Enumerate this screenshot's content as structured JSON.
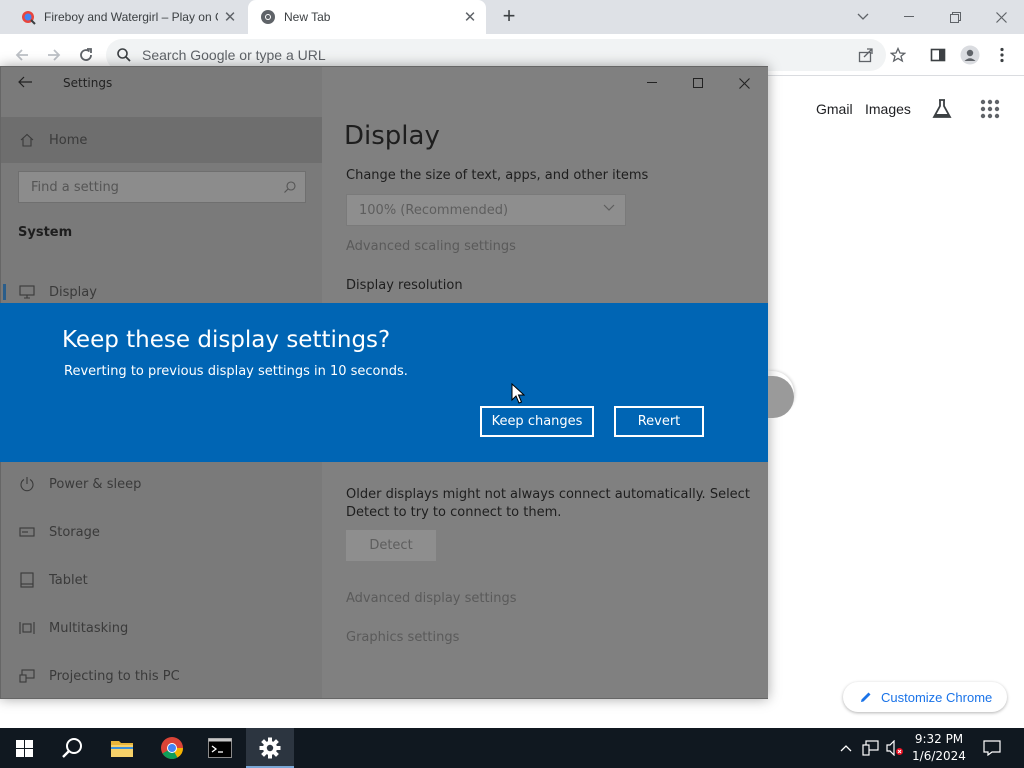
{
  "browser": {
    "tabs": [
      {
        "title": "Fireboy and Watergirl – Play on C",
        "close": "✕"
      },
      {
        "title": "New Tab",
        "close": "✕"
      }
    ],
    "new_tab": "+",
    "omnibox_placeholder": "Search Google or type a URL"
  },
  "ntp": {
    "links": [
      "Gmail",
      "Images"
    ],
    "customize_label": "Customize Chrome"
  },
  "settings": {
    "window_title": "Settings",
    "home_label": "Home",
    "search_placeholder": "Find a setting",
    "group_label": "System",
    "nav_items": [
      {
        "label": "Display",
        "icon": "monitor-icon"
      },
      {
        "label": "Power & sleep",
        "icon": "power-icon"
      },
      {
        "label": "Storage",
        "icon": "storage-icon"
      },
      {
        "label": "Tablet",
        "icon": "tablet-icon"
      },
      {
        "label": "Multitasking",
        "icon": "multitasking-icon"
      },
      {
        "label": "Projecting to this PC",
        "icon": "projecting-icon"
      }
    ],
    "heading": "Display",
    "scale_label": "Change the size of text, apps, and other items",
    "scale_value": "100% (Recommended)",
    "advanced_scaling": "Advanced scaling settings",
    "resolution_label": "Display resolution",
    "older_displays_text_line1": "Older displays might not always connect automatically. Select",
    "older_displays_text_line2": "Detect to try to connect to them.",
    "detect_label": "Detect",
    "advanced_display": "Advanced display settings",
    "graphics_settings": "Graphics settings"
  },
  "dialog": {
    "title": "Keep these display settings?",
    "message": "Reverting to previous display settings in 10 seconds.",
    "keep_label": "Keep changes",
    "revert_label": "Revert"
  },
  "taskbar": {
    "time": "9:32 PM",
    "date": "1/6/2024"
  },
  "colors": {
    "dialog_blue": "#0065b4",
    "link_blue": "#1a73e8",
    "taskbar": "#101820"
  }
}
